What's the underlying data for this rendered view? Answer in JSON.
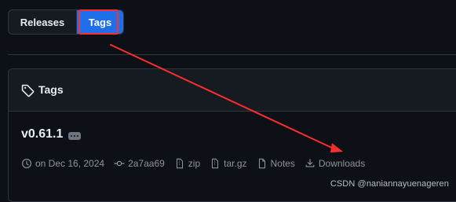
{
  "segmented": {
    "releases": "Releases",
    "tags": "Tags"
  },
  "panel": {
    "title": "Tags",
    "tag": {
      "version": "v0.61.1",
      "date": "on Dec 16, 2024",
      "commit": "2a7aa69",
      "zip": "zip",
      "targz": "tar.gz",
      "notes": "Notes",
      "downloads": "Downloads"
    }
  },
  "watermark": "CSDN @naniannayuenageren",
  "colors": {
    "background": "#0d1117",
    "header": "#161b22",
    "border": "#30363d",
    "accent": "#1f6feb",
    "annotation": "#ff2d2d"
  },
  "icons": [
    "tag-icon",
    "clock-icon",
    "commit-icon",
    "zip-icon",
    "file-zip-icon",
    "notes-icon",
    "download-icon"
  ]
}
